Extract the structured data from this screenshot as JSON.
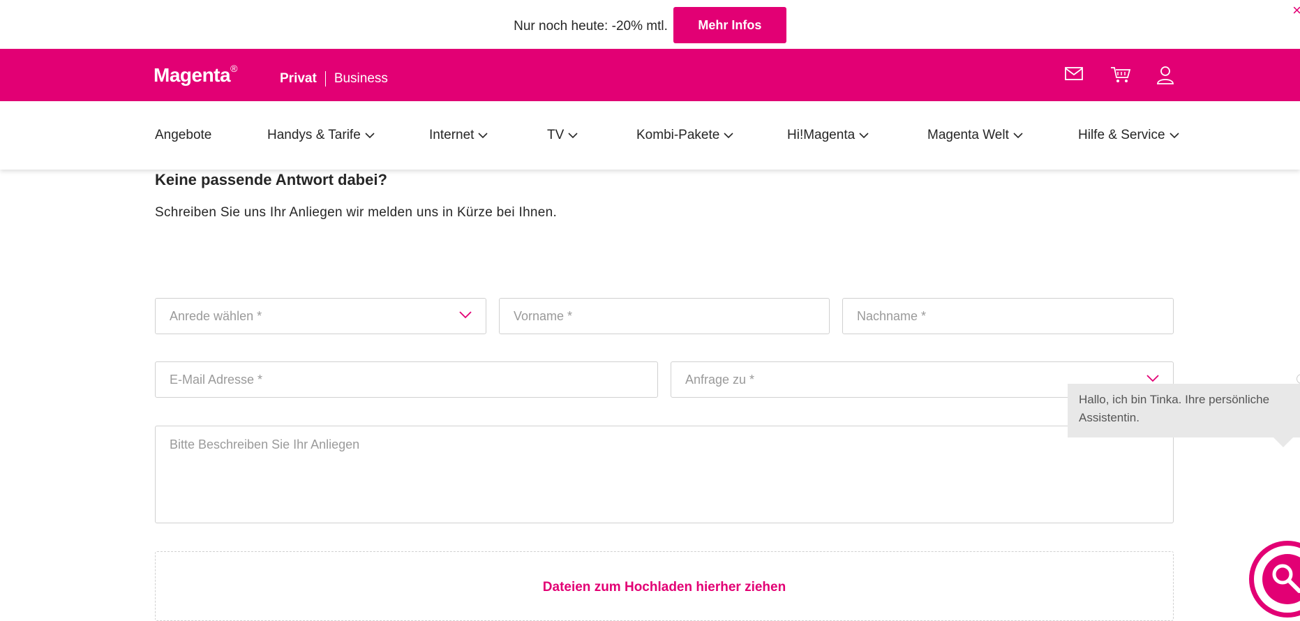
{
  "promo": {
    "text": "Nur noch heute: -20% mtl.",
    "button_label": "Mehr Infos",
    "close_glyph": "×"
  },
  "brand": {
    "logo_text": "Magenta",
    "logo_mark": "®",
    "segment_active": "Privat",
    "segment_other": "Business",
    "icons": [
      "mail-icon",
      "cart-icon",
      "user-icon"
    ],
    "color": "#e20074"
  },
  "nav": {
    "items": [
      {
        "label": "Angebote",
        "dropdown": false
      },
      {
        "label": "Handys & Tarife",
        "dropdown": true
      },
      {
        "label": "Internet",
        "dropdown": true
      },
      {
        "label": "TV",
        "dropdown": true
      },
      {
        "label": "Kombi-Pakete",
        "dropdown": true
      },
      {
        "label": "Hi!Magenta",
        "dropdown": true
      },
      {
        "label": "Magenta Welt",
        "dropdown": true
      },
      {
        "label": "Hilfe & Service",
        "dropdown": true
      }
    ]
  },
  "contact": {
    "title": "Keine passende Antwort dabei?",
    "subtitle": "Schreiben Sie uns Ihr Anliegen wir melden uns in Kürze bei Ihnen.",
    "salutation_placeholder": "Anrede wählen *",
    "firstname_placeholder": "Vorname *",
    "lastname_placeholder": "Nachname *",
    "email_placeholder": "E-Mail Adresse *",
    "topic_placeholder": "Anfrage zu *",
    "message_placeholder": "Bitte Beschreiben Sie Ihr Anliegen",
    "dropzone_label": "Dateien zum Hochladen hierher ziehen"
  },
  "chat": {
    "bubble_text": "Hallo, ich bin Tinka. Ihre persönliche Assistentin."
  }
}
